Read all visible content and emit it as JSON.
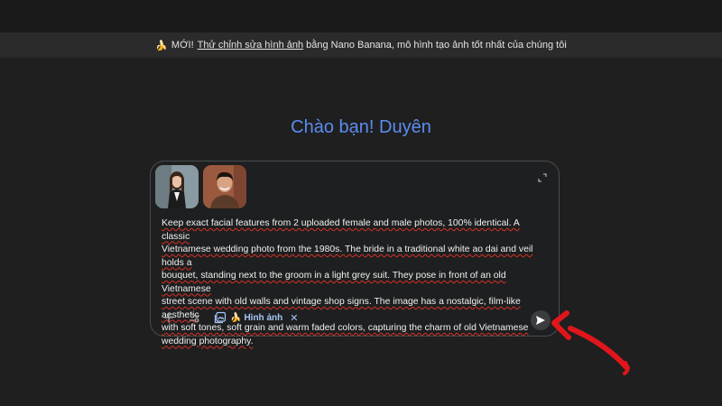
{
  "banner": {
    "emoji": "🍌",
    "prefix": "MỚI!",
    "link_text": "Thử chỉnh sửa hình ảnh",
    "suffix": "bằng Nano Banana, mô hình tạo ảnh tốt nhất của chúng tôi"
  },
  "greeting": "Chào bạn! Duyên",
  "composer": {
    "attachments": [
      {
        "name": "female-photo-thumbnail"
      },
      {
        "name": "male-photo-thumbnail"
      }
    ],
    "prompt_lines": [
      "Keep exact facial features from 2 uploaded female and male photos, 100% identical. A classic",
      "Vietnamese wedding photo from the 1980s. The bride in a traditional white ao dai and veil holds a",
      "bouquet, standing next to the groom in a light grey suit. They pose in front of an old Vietnamese",
      "street scene with old walls and vintage shop signs. The image has a nostalgic, film-like aesthetic",
      "with soft tones, soft grain and warm faded colors, capturing the charm of old Vietnamese",
      "wedding photography."
    ],
    "tool_chip": {
      "emoji": "🍌",
      "label": "Hình ảnh"
    }
  },
  "colors": {
    "accent": "#5b8def",
    "chip": "#a8c7fa",
    "annotation_arrow": "#e0161b"
  },
  "icons": [
    "plus-icon",
    "tools-icon",
    "image-gallery-icon",
    "close-icon",
    "expand-icon",
    "send-icon"
  ]
}
